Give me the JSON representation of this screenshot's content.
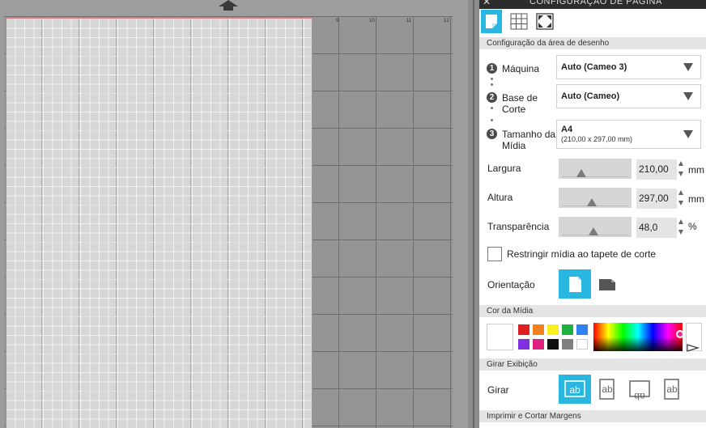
{
  "panel": {
    "title": "CONFIGURAÇÃO DE PÁGINA",
    "close_label": "✕",
    "tabs": [
      {
        "name": "tab-page-setup",
        "icon": "page-icon",
        "active": true
      },
      {
        "name": "tab-grid",
        "icon": "grid-icon",
        "active": false
      },
      {
        "name": "tab-registration",
        "icon": "registration-icon",
        "active": false
      }
    ]
  },
  "drawing_area": {
    "section_title": "Configuração da área de desenho",
    "machine": {
      "step": "1",
      "label": "Máquina",
      "value": "Auto (Cameo 3)"
    },
    "cutting_mat": {
      "step": "2",
      "label_line1": "Base de",
      "label_line2": "Corte",
      "value": "Auto (Cameo)"
    },
    "media_size": {
      "step": "3",
      "label_line1": "Tamanho da",
      "label_line2": "Mídia",
      "value": "A4",
      "sub": "(210,00 x 297,00 mm)"
    },
    "width": {
      "label": "Largura",
      "value": "210,00",
      "unit": "mm"
    },
    "height": {
      "label": "Altura",
      "value": "297,00",
      "unit": "mm"
    },
    "transparency": {
      "label": "Transparência",
      "value": "48,0",
      "unit": "%"
    },
    "restrict_label": "Restringir mídia ao tapete de corte",
    "orientation_label": "Orientação"
  },
  "media_color": {
    "section_title": "Cor da Mídia",
    "current": "#ffffff",
    "swatches": [
      "#e02020",
      "#f08020",
      "#f8f020",
      "#20b040",
      "#3080f0",
      "#8030e0",
      "#e02080",
      "#101010",
      "#808080",
      "#ffffff"
    ]
  },
  "rotate_view": {
    "section_title": "Girar Exibição",
    "label": "Girar",
    "buttons": [
      {
        "name": "rotate-0-button",
        "active": true
      },
      {
        "name": "rotate-90-button",
        "active": false
      },
      {
        "name": "rotate-180-button",
        "active": false
      },
      {
        "name": "rotate-270-button",
        "active": false
      }
    ]
  },
  "print_cut": {
    "section_title": "Imprimir e Cortar Margens"
  },
  "ruler": {
    "ticks": [
      "9",
      "10",
      "11",
      "12"
    ]
  },
  "colors": {
    "accent": "#29b6e0",
    "mat_border": "#e07a7a"
  }
}
